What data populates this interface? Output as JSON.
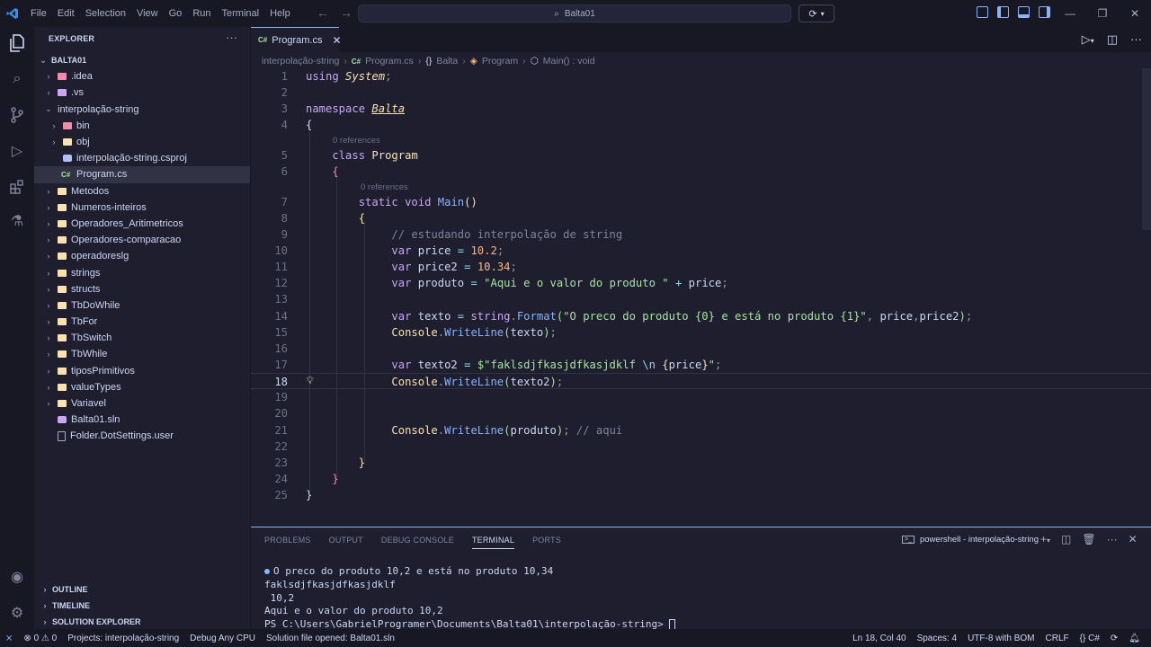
{
  "titlebar": {
    "menu": [
      "File",
      "Edit",
      "Selection",
      "View",
      "Go",
      "Run",
      "Terminal",
      "Help"
    ],
    "search_text": "Balta01"
  },
  "explorer": {
    "title": "EXPLORER",
    "root": "BALTA01",
    "items": [
      {
        "label": ".idea",
        "indent": 1,
        "chev": ">",
        "icon": "folder-red"
      },
      {
        "label": ".vs",
        "indent": 1,
        "chev": ">",
        "icon": "folder-purple"
      },
      {
        "label": "interpolação-string",
        "indent": 1,
        "chev": "v",
        "icon": "none"
      },
      {
        "label": "bin",
        "indent": 2,
        "chev": ">",
        "icon": "folder-red"
      },
      {
        "label": "obj",
        "indent": 2,
        "chev": ">",
        "icon": "folder"
      },
      {
        "label": "interpolação-string.csproj",
        "indent": 2,
        "chev": "",
        "icon": "file-proj"
      },
      {
        "label": "Program.cs",
        "indent": 2,
        "chev": "",
        "icon": "file-cs",
        "active": true
      },
      {
        "label": "Metodos",
        "indent": 1,
        "chev": ">",
        "icon": "folder"
      },
      {
        "label": "Numeros-inteiros",
        "indent": 1,
        "chev": ">",
        "icon": "folder"
      },
      {
        "label": "Operadores_Aritimetricos",
        "indent": 1,
        "chev": ">",
        "icon": "folder"
      },
      {
        "label": "Operadores-comparacao",
        "indent": 1,
        "chev": ">",
        "icon": "folder"
      },
      {
        "label": "operadoreslg",
        "indent": 1,
        "chev": ">",
        "icon": "folder"
      },
      {
        "label": "strings",
        "indent": 1,
        "chev": ">",
        "icon": "folder"
      },
      {
        "label": "structs",
        "indent": 1,
        "chev": ">",
        "icon": "folder"
      },
      {
        "label": "TbDoWhile",
        "indent": 1,
        "chev": ">",
        "icon": "folder"
      },
      {
        "label": "TbFor",
        "indent": 1,
        "chev": ">",
        "icon": "folder"
      },
      {
        "label": "TbSwitch",
        "indent": 1,
        "chev": ">",
        "icon": "folder"
      },
      {
        "label": "TbWhile",
        "indent": 1,
        "chev": ">",
        "icon": "folder"
      },
      {
        "label": "tiposPrimitivos",
        "indent": 1,
        "chev": ">",
        "icon": "folder"
      },
      {
        "label": "valueTypes",
        "indent": 1,
        "chev": ">",
        "icon": "folder"
      },
      {
        "label": "Variavel",
        "indent": 1,
        "chev": ">",
        "icon": "folder"
      },
      {
        "label": "Balta01.sln",
        "indent": 1,
        "chev": "",
        "icon": "file-sln"
      },
      {
        "label": "Folder.DotSettings.user",
        "indent": 1,
        "chev": "",
        "icon": "file-plain"
      }
    ],
    "bottom_sections": [
      "OUTLINE",
      "TIMELINE",
      "SOLUTION EXPLORER"
    ]
  },
  "tab": {
    "label": "Program.cs",
    "lang_badge": "C#"
  },
  "breadcrumb": [
    "interpolação-string",
    "Program.cs",
    "Balta",
    "Program",
    "Main() : void"
  ],
  "codelens": "0 references",
  "current_line": 18,
  "terminal": {
    "tabs": [
      "PROBLEMS",
      "OUTPUT",
      "DEBUG CONSOLE",
      "TERMINAL",
      "PORTS"
    ],
    "active_tab": "TERMINAL",
    "name": "powershell - interpolação-string",
    "lines": [
      "O preco do produto 10,2 e está no produto 10,34",
      "faklsdjfkasjdfkasjdklf",
      " 10,2",
      "Aqui e o valor do produto 10,2",
      "PS C:\\Users\\GabrielProgramer\\Documents\\Balta01\\interpolação-string> "
    ]
  },
  "statusbar": {
    "errors": "0",
    "warnings": "0",
    "projects": "Projects: interpolação-string",
    "debug": "Debug Any CPU",
    "solution": "Solution file opened: Balta01.sln",
    "position": "Ln 18, Col 40",
    "spaces": "Spaces: 4",
    "encoding": "UTF-8 with BOM",
    "eol": "CRLF",
    "language": "C#"
  },
  "colors": {
    "accent": "#89b4fa",
    "keyword": "#cba6f7",
    "string": "#a6e3a1",
    "number": "#fab387",
    "type": "#f9e2af"
  }
}
